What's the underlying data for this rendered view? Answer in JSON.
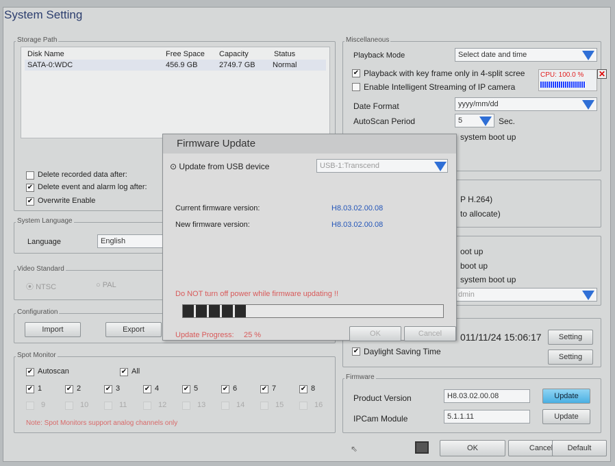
{
  "window": {
    "title": "System Setting"
  },
  "storage": {
    "legend": "Storage Path",
    "headers": {
      "disk": "Disk Name",
      "free": "Free Space",
      "capacity": "Capacity",
      "status": "Status"
    },
    "rows": [
      {
        "disk": "SATA-0:WDC",
        "free": "456.9 GB",
        "capacity": "2749.7 GB",
        "status": "Normal"
      }
    ],
    "delete_recorded": "Delete recorded data after:",
    "delete_event": "Delete event and alarm log after:",
    "overwrite": "Overwrite Enable"
  },
  "language": {
    "legend": "System Language",
    "label": "Language",
    "value": "English"
  },
  "video": {
    "legend": "Video Standard",
    "ntsc": "NTSC",
    "pal": "PAL"
  },
  "config": {
    "legend": "Configuration",
    "import": "Import",
    "export": "Export"
  },
  "spot": {
    "legend": "Spot Monitor",
    "autoscan": "Autoscan",
    "all": "All",
    "channels_on": [
      "1",
      "2",
      "3",
      "4",
      "5",
      "6",
      "7",
      "8"
    ],
    "channels_off": [
      "9",
      "10",
      "11",
      "12",
      "13",
      "14",
      "15",
      "16"
    ],
    "note": "Note: Spot Monitors support analog channels only"
  },
  "misc": {
    "legend": "Miscellaneous",
    "playback_mode_label": "Playback Mode",
    "playback_mode_value": "Select date and time",
    "keyframe": "Playback with key frame only in 4-split scree",
    "intelligent": "Enable Intelligent Streaming of IP camera",
    "date_format_label": "Date Format",
    "date_format_value": "yyyy/mm/dd",
    "autoscan_label": "AutoScan Period",
    "autoscan_value": "5",
    "autoscan_unit": "Sec.",
    "boot_partial": "system boot up"
  },
  "partial": {
    "h264": "P H.264)",
    "allocate": "to allocate)",
    "boot1": "oot up",
    "boot2": "boot up",
    "boot3": "system boot up",
    "admin": "dmin"
  },
  "time": {
    "datetime": "011/11/24  15:06:17",
    "setting": "Setting",
    "dst": "Daylight Saving Time",
    "dst_setting": "Setting"
  },
  "firmware": {
    "legend": "Firmware",
    "product_label": "Product Version",
    "product_value": "H8.03.02.00.08",
    "ipcam_label": "IPCam Module",
    "ipcam_value": "5.1.1.11",
    "update": "Update",
    "update2": "Update"
  },
  "cpu": {
    "label": "CPU: 100.0 %",
    "level": 100
  },
  "bottom": {
    "ok": "OK",
    "cancel": "Cancel",
    "default": "Default"
  },
  "dialog": {
    "title": "Firmware Update",
    "source_label": "Update from USB device",
    "source_value": "USB-1:Transcend",
    "current_label": "Current firmware version:",
    "current_value": "H8.03.02.00.08",
    "new_label": "New firmware version:",
    "new_value": "H8.03.02.00.08",
    "warning": "Do NOT turn off power while firmware updating !!",
    "progress_label": "Update Progress:",
    "progress_value": "25 %",
    "progress_fraction": 0.25,
    "ok": "OK",
    "cancel": "Cancel"
  },
  "colors": {
    "accent": "#2f6fd6",
    "warning": "#cc4444",
    "version_blue": "#2355b8"
  }
}
